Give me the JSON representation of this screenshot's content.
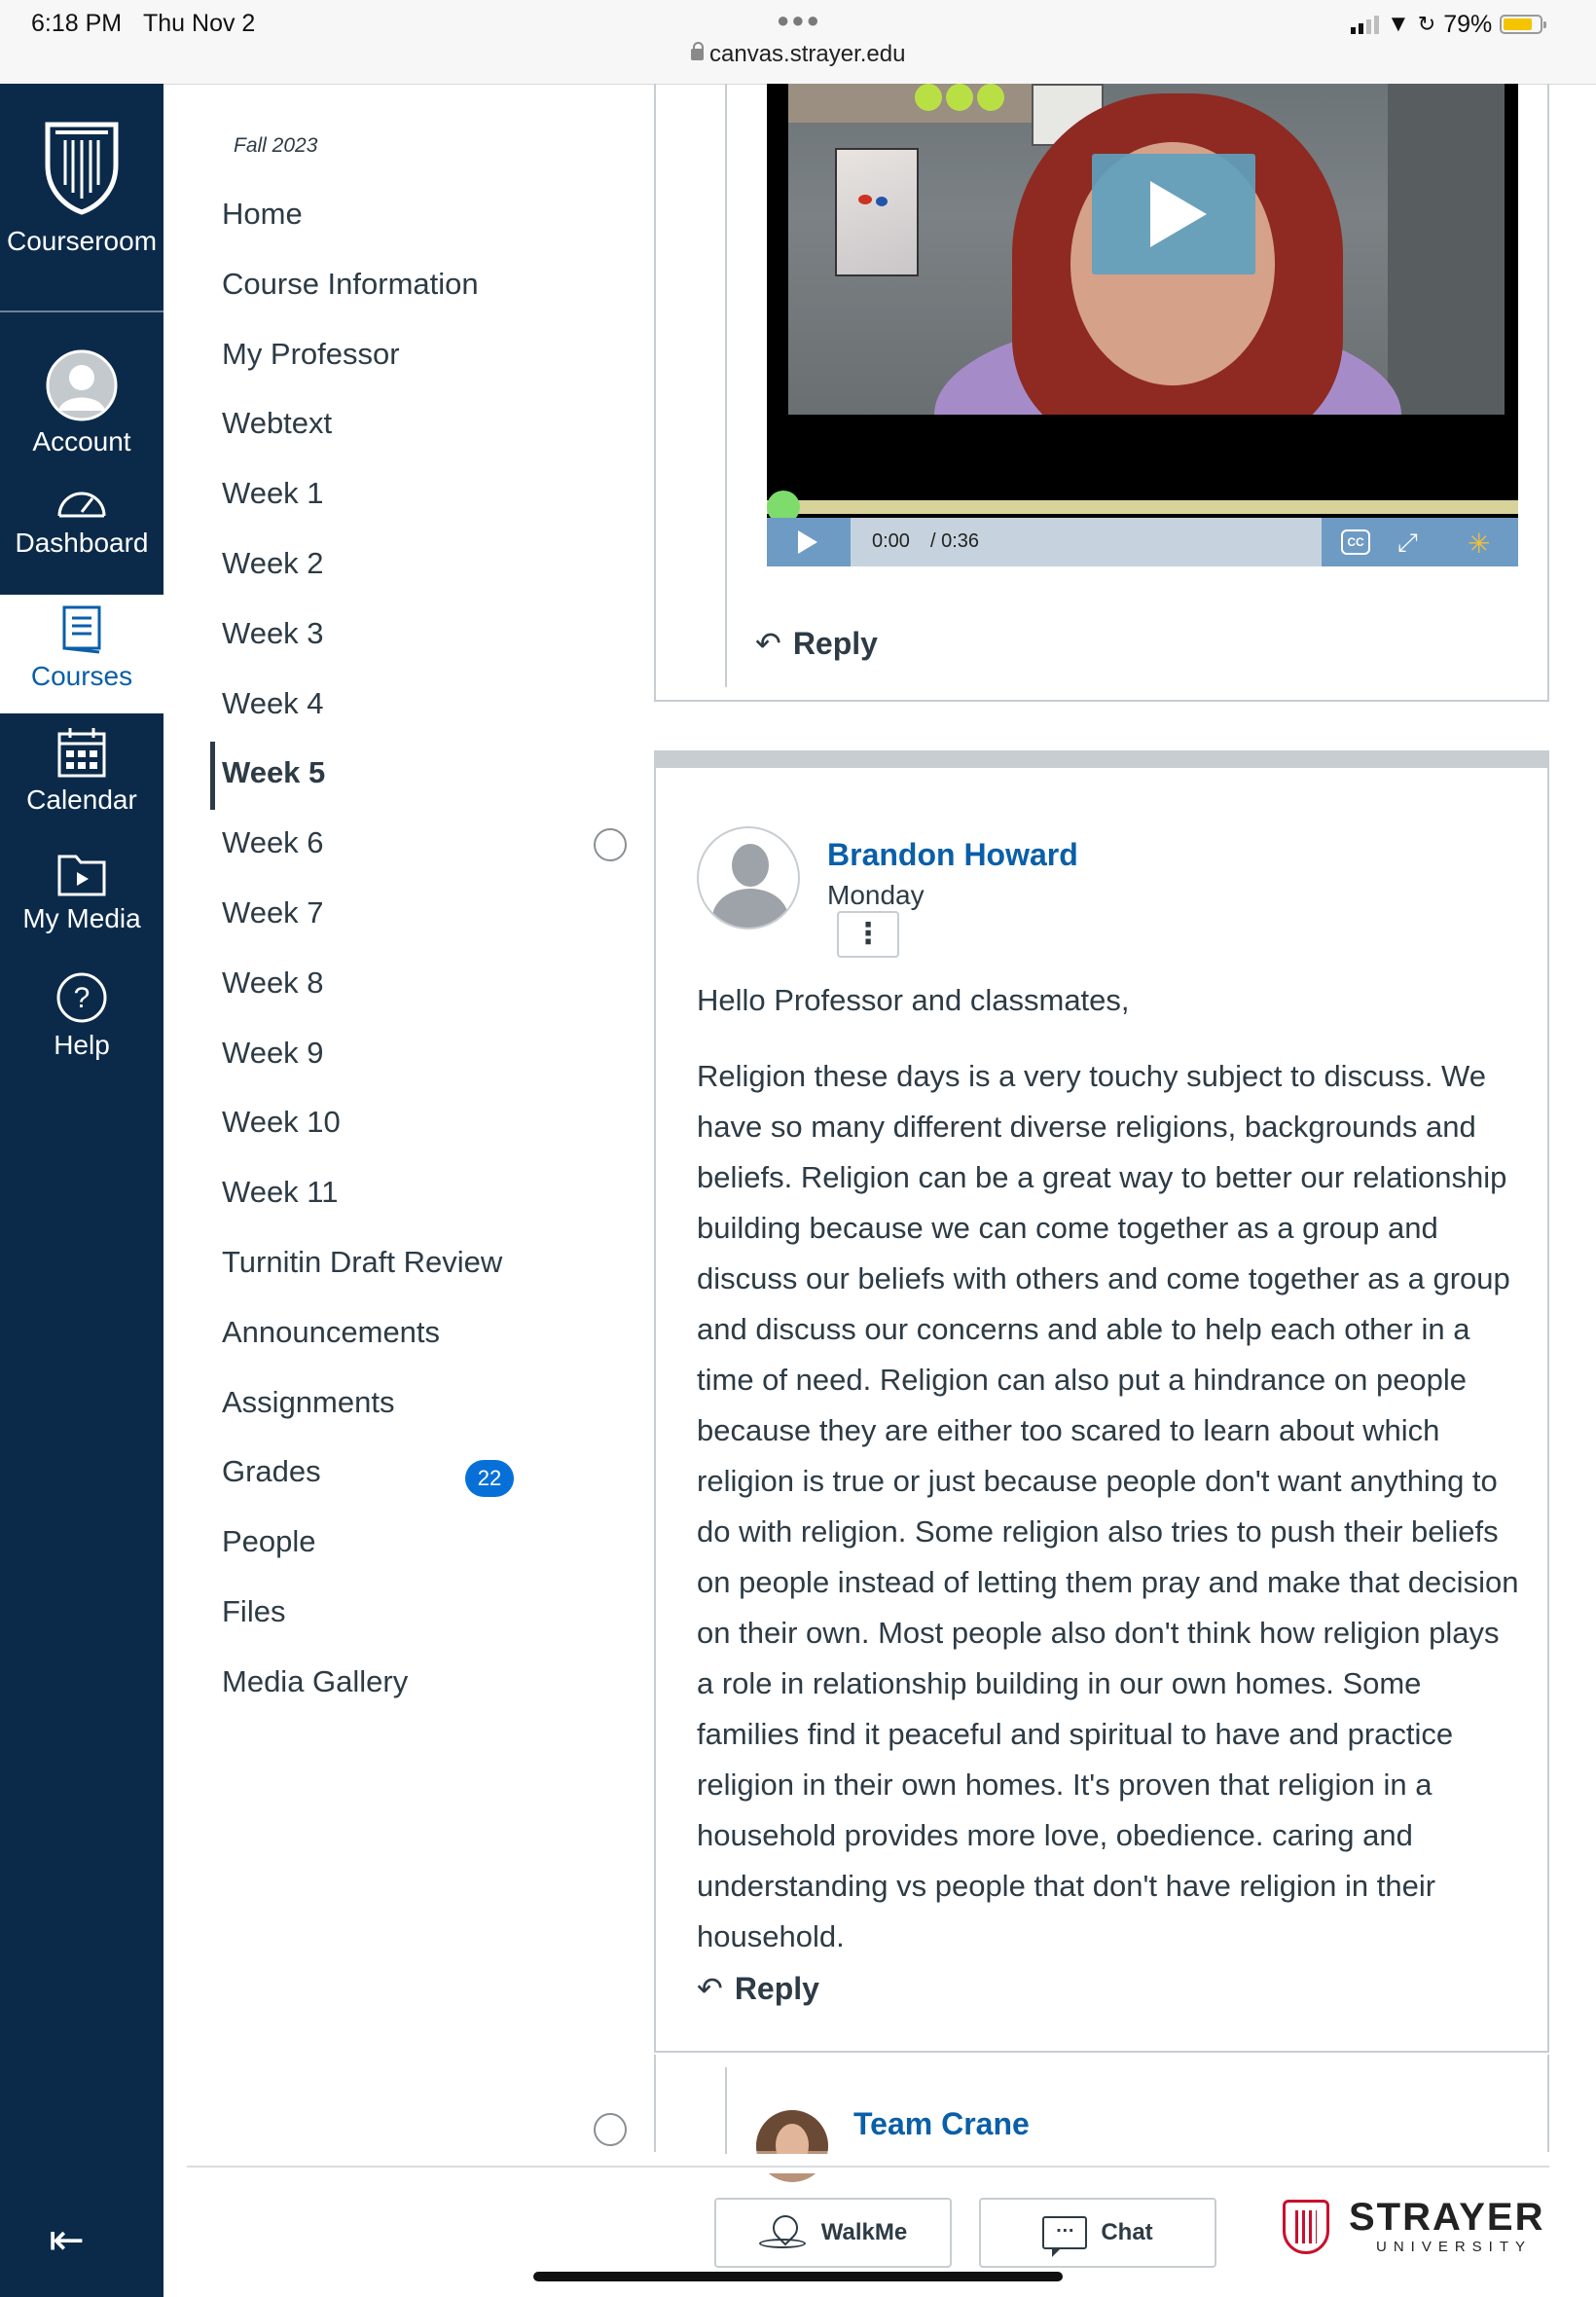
{
  "status_bar": {
    "time": "6:18 PM",
    "date": "Thu Nov 2",
    "url": "canvas.strayer.edu",
    "battery": "79%",
    "battery_level": 0.79
  },
  "global_nav": {
    "logo_label": "Courseroom",
    "items": [
      {
        "label": "Account",
        "icon": "account-icon"
      },
      {
        "label": "Dashboard",
        "icon": "dashboard-icon"
      },
      {
        "label": "Courses",
        "icon": "courses-icon",
        "active": true
      },
      {
        "label": "Calendar",
        "icon": "calendar-icon"
      },
      {
        "label": "My Media",
        "icon": "media-icon"
      },
      {
        "label": "Help",
        "icon": "help-icon"
      }
    ],
    "collapse_icon": "collapse-icon"
  },
  "course_nav": {
    "term": "Fall 2023",
    "items": [
      "Home",
      "Course Information",
      "My Professor",
      "Webtext",
      "Week 1",
      "Week 2",
      "Week 3",
      "Week 4",
      "Week 5",
      "Week 6",
      "Week 7",
      "Week 8",
      "Week 9",
      "Week 10",
      "Week 11",
      "Turnitin Draft Review",
      "Announcements",
      "Assignments",
      "Grades",
      "People",
      "Files",
      "Media Gallery"
    ],
    "active": "Week 5",
    "grades_badge": "22"
  },
  "video": {
    "current_time": "0:00",
    "duration": "/ 0:36",
    "cc_label": "CC"
  },
  "reply_label": "Reply",
  "post": {
    "author": "Brandon Howard",
    "date": "Monday",
    "greeting": "Hello Professor and classmates,",
    "body": "Religion these days is a very touchy subject to discuss.  We have so many different diverse religions, backgrounds and beliefs.  Religion can be a great way to better our relationship building because we can come together as a group and discuss our beliefs with others and come together as a group and discuss our concerns and able to help each other in a time of need.  Religion can also put a hindrance on people because they are either too scared to learn about which religion is true or just because people don't want anything to do with religion.  Some religion also tries to push their beliefs on people instead of letting them pray and make that decision on their own.  Most people also don't think how religion plays a role in relationship building in our own homes.  Some families find it peaceful and spiritual to have and practice religion in their own homes.  It's proven that religion in a household provides more love, obedience. caring and understanding vs people that don't have religion in their household."
  },
  "next_post": {
    "author": "Team Crane"
  },
  "footer": {
    "walkme_label": "WalkMe",
    "chat_label": "Chat",
    "brand_name": "STRAYER",
    "brand_sub": "UNIVERSITY"
  },
  "colors": {
    "nav_bg": "#0b2a4a",
    "link_blue": "#0a5fa8",
    "badge_blue": "#0770d8",
    "brand_red": "#c8102e"
  }
}
